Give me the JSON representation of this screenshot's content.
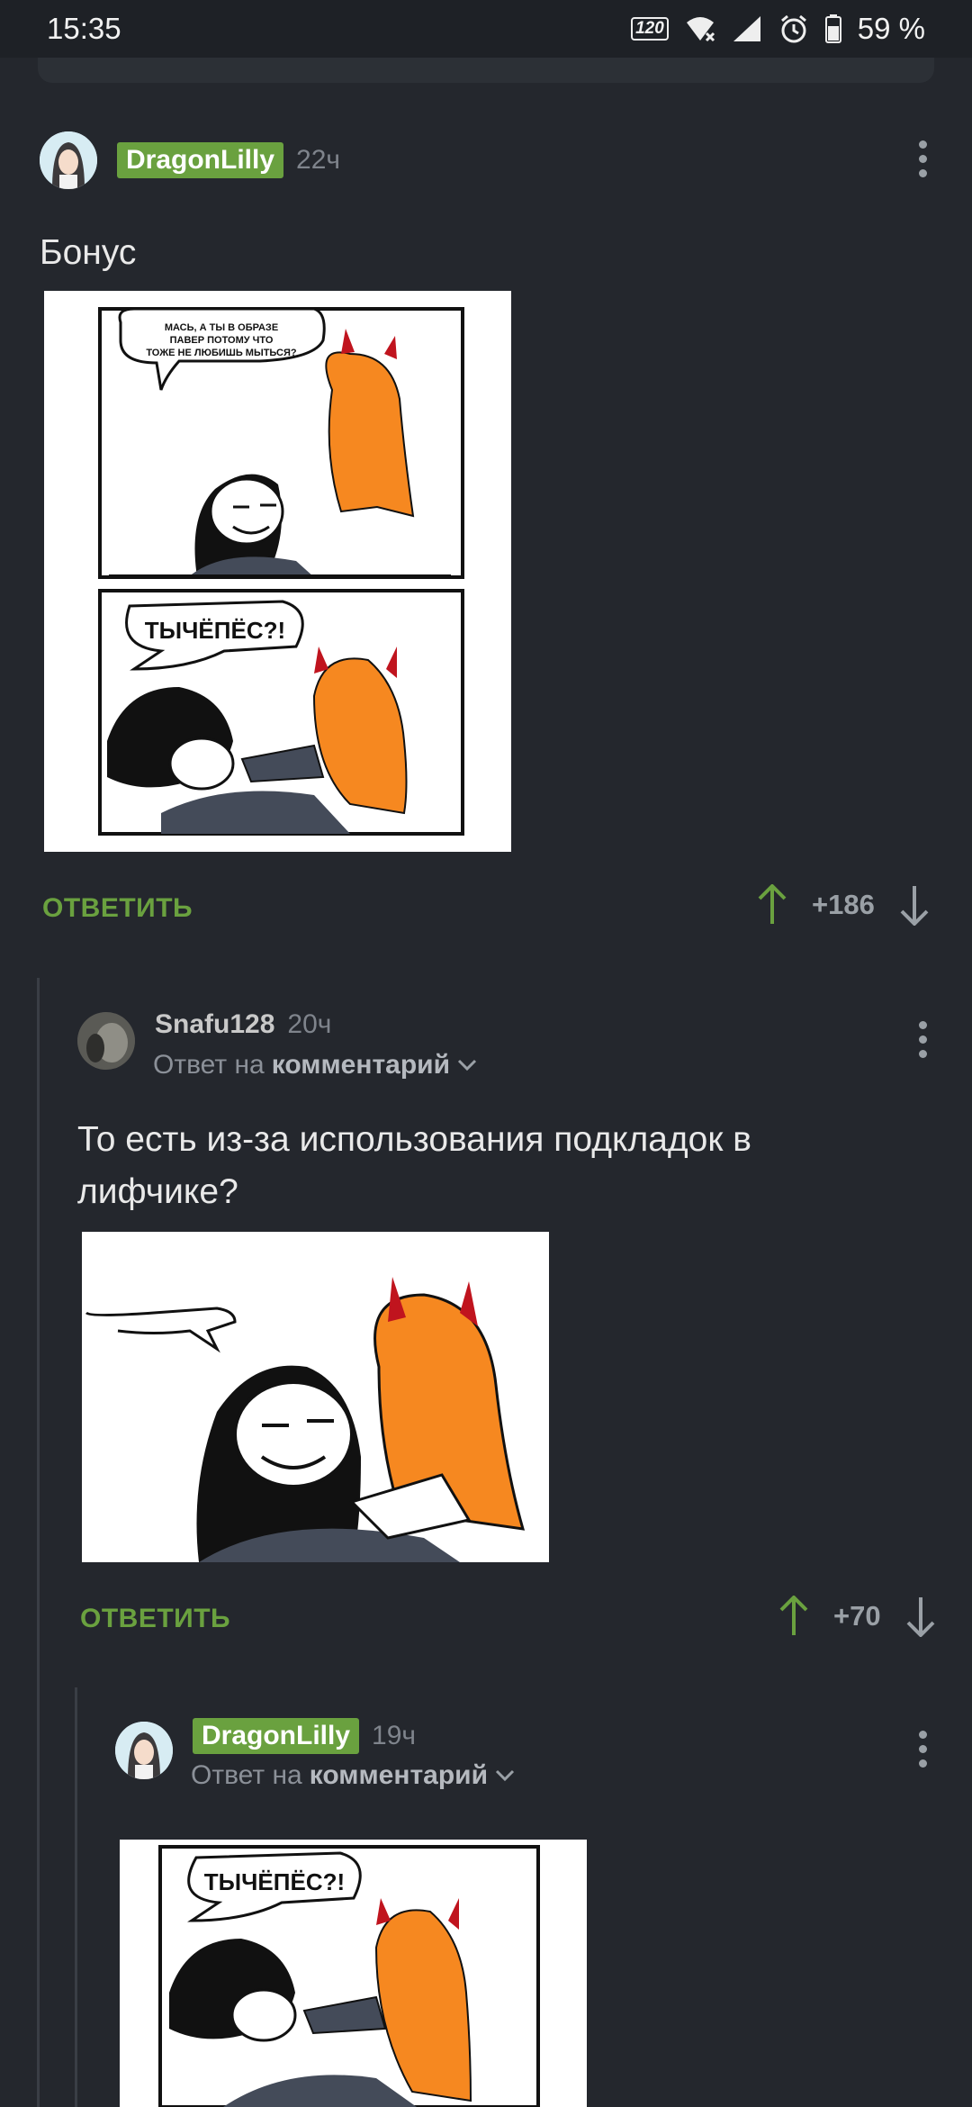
{
  "status_bar": {
    "time": "15:35",
    "battery": "59 %",
    "refresh_rate": "120"
  },
  "comments": [
    {
      "author": "DragonLilly",
      "time": "22ч",
      "text": "Бонус",
      "reply_label": "ОТВЕТИТЬ",
      "rating": "+186",
      "image": {
        "panel1_caption": "МАСЬ, А ТЫ В ОБРАЗЕ ПАВЕР ПОТОМУ ЧТО ТОЖЕ НЕ ЛЮБИШЬ МЫТЬСЯ?",
        "panel2_caption": "ТЫЧЁПЁС?!"
      }
    },
    {
      "author": "Snafu128",
      "time": "20ч",
      "reply_prefix": "Ответ на",
      "reply_target": "комментарий",
      "text": "То есть из-за использования подкладок в лифчике?",
      "reply_label": "ОТВЕТИТЬ",
      "rating": "+70"
    },
    {
      "author": "DragonLilly",
      "time": "19ч",
      "reply_prefix": "Ответ на",
      "reply_target": "комментарий",
      "image": {
        "panel_caption": "ТЫЧЁПЁС?!"
      }
    }
  ],
  "colors": {
    "accent": "#6aa13f",
    "background": "#24272d"
  },
  "icons": [
    "wifi-icon",
    "signal-icon",
    "alarm-icon",
    "battery-icon",
    "upvote-arrow-icon",
    "downvote-arrow-icon",
    "more-vertical-icon",
    "chevron-down-icon"
  ]
}
